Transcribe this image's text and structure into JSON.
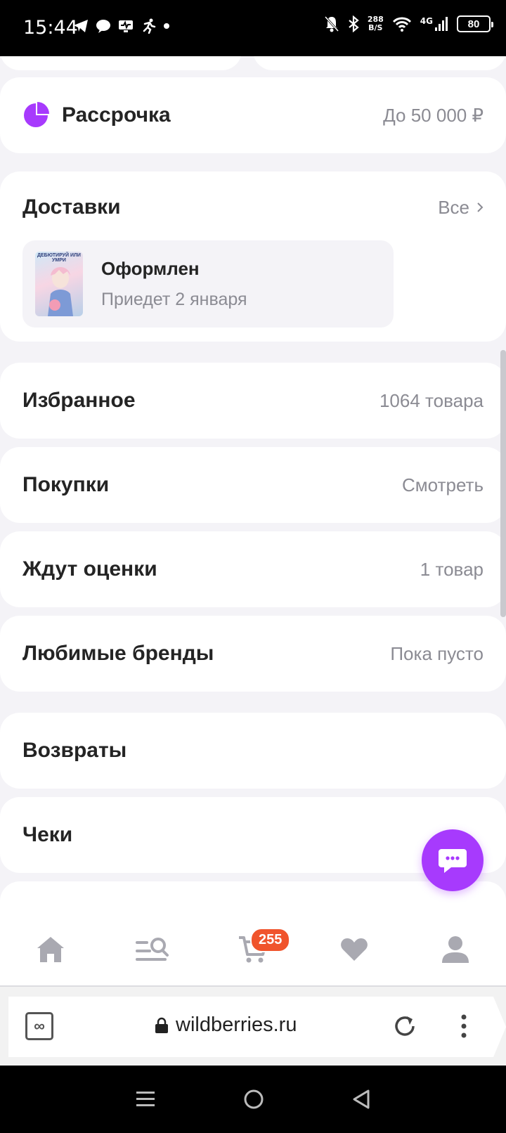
{
  "status_bar": {
    "time": "15:44",
    "speed_value": "288",
    "speed_unit": "B/S",
    "network": "4G",
    "battery": "80",
    "icons_left": [
      "telegram-icon",
      "chat-bubble-icon",
      "monitor-icon",
      "runner-icon",
      "dot-icon"
    ],
    "icons_right": [
      "mute-bell-icon",
      "bluetooth-icon",
      "wifi-icon",
      "signal-icon"
    ]
  },
  "installment": {
    "title": "Рассрочка",
    "value": "До 50 000 ₽",
    "icon_color": "#a73afd"
  },
  "deliveries": {
    "title": "Доставки",
    "all_label": "Все",
    "item": {
      "thumb_title": "ДЕБЮТИРУЙ ИЛИ УМРИ",
      "status": "Оформлен",
      "date": "Приедет 2 января"
    }
  },
  "rows": [
    {
      "title": "Избранное",
      "value": "1064 товара"
    },
    {
      "title": "Покупки",
      "value": "Смотреть"
    },
    {
      "title": "Ждут оценки",
      "value": "1 товар"
    },
    {
      "title": "Любимые бренды",
      "value": "Пока пусто"
    },
    {
      "title": "Возвраты",
      "value": ""
    },
    {
      "title": "Чеки",
      "value": ""
    }
  ],
  "tabbar": {
    "items": [
      "home-icon",
      "catalog-search-icon",
      "cart-icon",
      "favorites-heart-icon",
      "profile-icon"
    ],
    "cart_badge": "255"
  },
  "browser": {
    "url": "wildberries.ru",
    "tabs_symbol": "∞"
  },
  "colors": {
    "accent": "#a73afd",
    "badge": "#f0542c",
    "icon_gray": "#a9a9b1"
  }
}
